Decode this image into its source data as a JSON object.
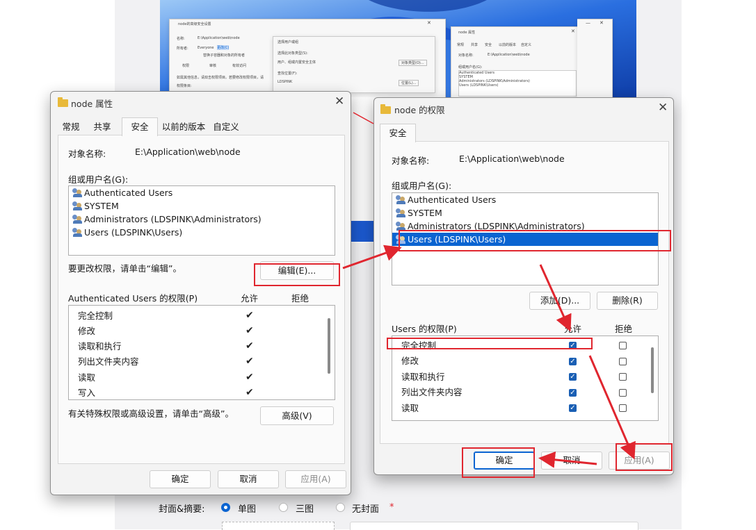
{
  "bg_small_window": {
    "title": "node的高级安全设置",
    "name_label": "名称:",
    "name_value": "E:\\Application\\web\\node",
    "owner_label": "所有者:",
    "owner_value": "Everyone",
    "owner_link": "更改(C)",
    "replace_owner": "替换子容器和对象的所有者",
    "tabs": [
      "权限",
      "审核",
      "有效访问"
    ],
    "info_line": "如需其他信息，请双击权限项目。若要修改权限项目，请",
    "perm_entries": "权限条目:"
  },
  "bg_select_dialog": {
    "title": "选择用户或组",
    "object_type_label": "选择此对象类型(S):",
    "object_type_value": "用户、组或内置安全主体",
    "object_type_button": "对象类型(O)...",
    "location_label": "查找位置(F):",
    "location_value": "LDSPINK",
    "location_button": "位置(L)..."
  },
  "bg_props_small": {
    "title": "node 属性",
    "tabs": [
      "常规",
      "共享",
      "安全",
      "以前的版本",
      "自定义"
    ],
    "object_label": "对象名称:",
    "object_value": "E:\\Application\\web\\node",
    "group_label": "组或用户名(G):",
    "users": [
      "Authenticated Users",
      "SYSTEM",
      "Administrators (LDSPINK\\Administrators)",
      "Users (LDSPINK\\Users)"
    ]
  },
  "props_dialog": {
    "title": "node 属性",
    "tabs": [
      "常规",
      "共享",
      "安全",
      "以前的版本",
      "自定义"
    ],
    "active_tab": "安全",
    "object_label": "对象名称:",
    "object_value": "E:\\Application\\web\\node",
    "group_label": "组或用户名(G):",
    "users": [
      "Authenticated Users",
      "SYSTEM",
      "Administrators (LDSPINK\\Administrators)",
      "Users (LDSPINK\\Users)"
    ],
    "edit_hint": "要更改权限，请单击“编辑”。",
    "edit_button": "编辑(E)...",
    "perm_title": "Authenticated Users 的权限(P)",
    "allow_header": "允许",
    "deny_header": "拒绝",
    "permissions": [
      {
        "name": "完全控制",
        "allow": true
      },
      {
        "name": "修改",
        "allow": true
      },
      {
        "name": "读取和执行",
        "allow": true
      },
      {
        "name": "列出文件夹内容",
        "allow": true
      },
      {
        "name": "读取",
        "allow": true
      },
      {
        "name": "写入",
        "allow": true
      }
    ],
    "advanced_hint": "有关特殊权限或高级设置，请单击“高级”。",
    "advanced_button": "高级(V)",
    "ok_button": "确定",
    "cancel_button": "取消",
    "apply_button": "应用(A)"
  },
  "perm_dialog": {
    "title": "node 的权限",
    "tab": "安全",
    "object_label": "对象名称:",
    "object_value": "E:\\Application\\web\\node",
    "group_label": "组或用户名(G):",
    "users": [
      "Authenticated Users",
      "SYSTEM",
      "Administrators (LDSPINK\\Administrators)",
      "Users (LDSPINK\\Users)"
    ],
    "selected_user_index": 3,
    "add_button": "添加(D)...",
    "remove_button": "删除(R)",
    "perm_title": "Users 的权限(P)",
    "allow_header": "允许",
    "deny_header": "拒绝",
    "permissions": [
      {
        "name": "完全控制",
        "allow": true,
        "deny": false
      },
      {
        "name": "修改",
        "allow": true,
        "deny": false
      },
      {
        "name": "读取和执行",
        "allow": true,
        "deny": false
      },
      {
        "name": "列出文件夹内容",
        "allow": true,
        "deny": false
      },
      {
        "name": "读取",
        "allow": true,
        "deny": false
      }
    ],
    "ok_button": "确定",
    "cancel_button": "取消",
    "apply_button": "应用(A)"
  },
  "form": {
    "label": "封面&摘要:",
    "options": [
      "单图",
      "三图",
      "无封面"
    ],
    "selected": 0,
    "required_mark": "*"
  },
  "colors": {
    "accent": "#0a64d1",
    "annotation_red": "#e0262f",
    "folder": "#e8b93a"
  }
}
